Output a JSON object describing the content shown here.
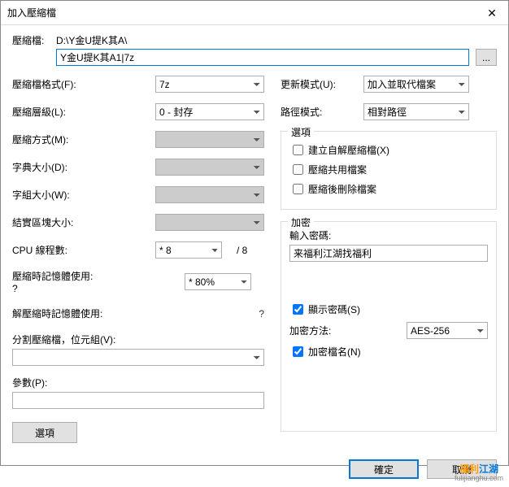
{
  "window": {
    "title": "加入壓縮檔"
  },
  "top": {
    "label": "壓縮檔:",
    "path1": "D:\\Y金U提K其A\\",
    "path2": "Y金U提K其A1|7z",
    "browse": "..."
  },
  "left": {
    "format": {
      "label": "壓縮檔格式(F):",
      "value": "7z"
    },
    "level": {
      "label": "壓縮層級(L):",
      "value": "0 - 封存"
    },
    "method": {
      "label": "壓縮方式(M):",
      "value": ""
    },
    "dict": {
      "label": "字典大小(D):",
      "value": ""
    },
    "word": {
      "label": "字組大小(W):",
      "value": ""
    },
    "block": {
      "label": "結實區塊大小:",
      "value": ""
    },
    "threads": {
      "label": "CPU 線程數:",
      "value": "* 8",
      "total": "/ 8"
    },
    "memc": {
      "label": "壓縮時記憶體使用:",
      "q": "?",
      "value": "* 80%"
    },
    "memd": {
      "label": "解壓縮時記憶體使用:",
      "q": "?"
    },
    "split": {
      "label": "分割壓縮檔，位元組(V):",
      "value": ""
    },
    "params": {
      "label": "參數(P):",
      "value": ""
    },
    "optsbtn": "選項"
  },
  "right": {
    "update": {
      "label": "更新模式(U):",
      "value": "加入並取代檔案"
    },
    "pathmode": {
      "label": "路徑模式:",
      "value": "相對路徑"
    },
    "opts": {
      "legend": "選項",
      "sfx": "建立自解壓縮檔(X)",
      "shared": "壓縮共用檔案",
      "delafter": "壓縮後刪除檔案"
    },
    "enc": {
      "legend": "加密",
      "pwdlabel": "輸入密碼:",
      "pwd": "来福利江湖找福利",
      "showpwd": "顯示密碼(S)",
      "methodlabel": "加密方法:",
      "method": "AES-256",
      "encnames": "加密檔名(N)"
    }
  },
  "buttons": {
    "ok": "確定",
    "cancel": "取消"
  },
  "watermark": {
    "t1a": "福利",
    "t1b": "江湖",
    "t2": "fulijianghu.com"
  }
}
